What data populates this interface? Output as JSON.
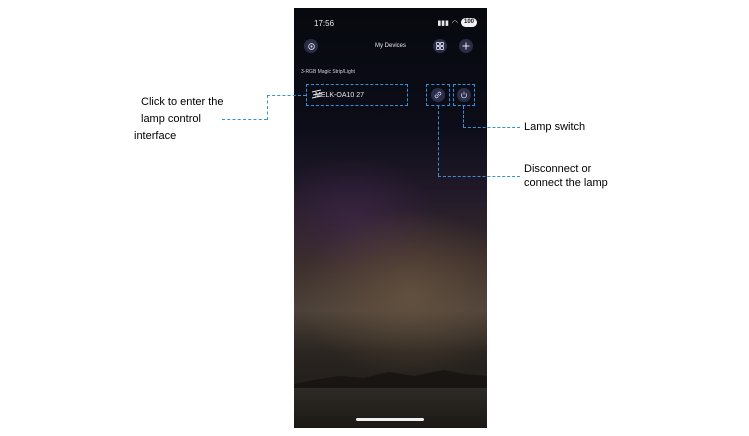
{
  "status": {
    "time": "17:56",
    "battery": "100"
  },
  "header": {
    "title": "My Devices"
  },
  "section": {
    "label": "3-RGB Magic Strip/Light"
  },
  "device": {
    "name": "MELK-OA10  27"
  },
  "annotations": {
    "enter_control": [
      "Click to enter the",
      "lamp control",
      "interface"
    ],
    "lamp_switch": "Lamp switch",
    "disconnect": [
      "Disconnect or",
      "connect the lamp"
    ]
  },
  "colors": {
    "accent_dash": "#3a8fd6",
    "button_bg": "#2c2f4a"
  },
  "icons": [
    "settings-icon",
    "grid-icon",
    "plus-icon",
    "lightning-strip-icon",
    "link-icon",
    "power-icon"
  ]
}
